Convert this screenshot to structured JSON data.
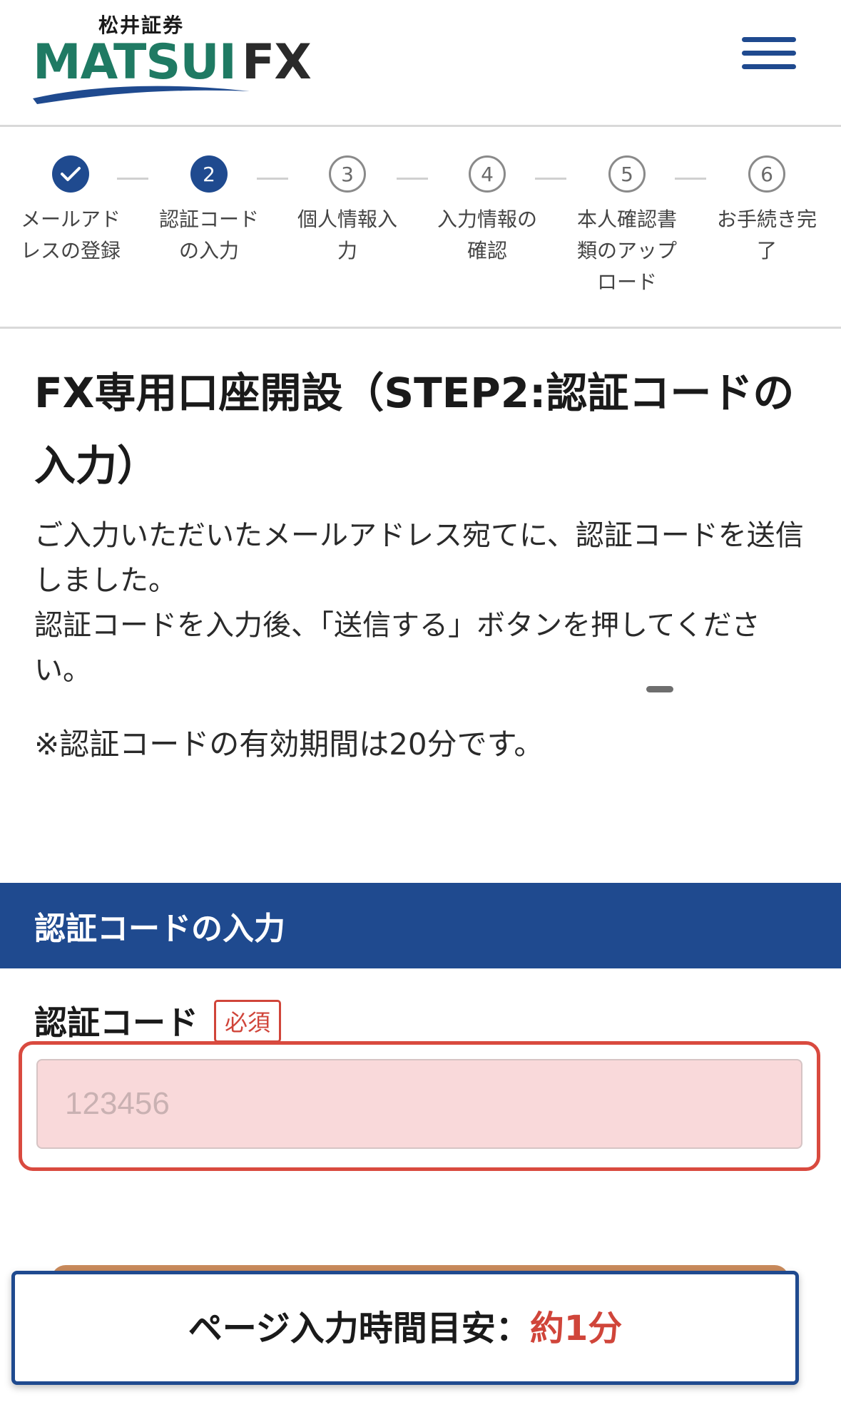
{
  "header": {
    "logo_sub": "松井証券",
    "logo_main": "MATSUI",
    "logo_fx": "FX"
  },
  "stepper": {
    "steps": [
      {
        "num": "✓",
        "label": "メールアドレスの登録",
        "state": "done"
      },
      {
        "num": "2",
        "label": "認証コードの入力",
        "state": "active"
      },
      {
        "num": "3",
        "label": "個人情報入力",
        "state": "pending"
      },
      {
        "num": "4",
        "label": "入力情報の確認",
        "state": "pending"
      },
      {
        "num": "5",
        "label": "本人確認書類のアップロード",
        "state": "pending"
      },
      {
        "num": "6",
        "label": "お手続き完了",
        "state": "pending"
      }
    ]
  },
  "main": {
    "title": "FX専用口座開設（STEP2:認証コードの入力）",
    "intro_1": "ご入力いただいたメールアドレス宛てに、認証コードを送信しました。",
    "intro_2": "認証コードを入力後、「送信する」ボタンを押してください。",
    "note": "※認証コードの有効期間は20分です。"
  },
  "section": {
    "heading": "認証コードの入力",
    "field_label": "認証コード",
    "required_badge": "必須",
    "input_placeholder": "123456",
    "input_value": ""
  },
  "footer": {
    "time_label": "ページ入力時間目安：",
    "time_value": "約1分"
  },
  "colors": {
    "brand_blue": "#1f4a8f",
    "brand_green": "#1f7a63",
    "error_red": "#d0453a",
    "input_bg": "#f9d9da"
  }
}
